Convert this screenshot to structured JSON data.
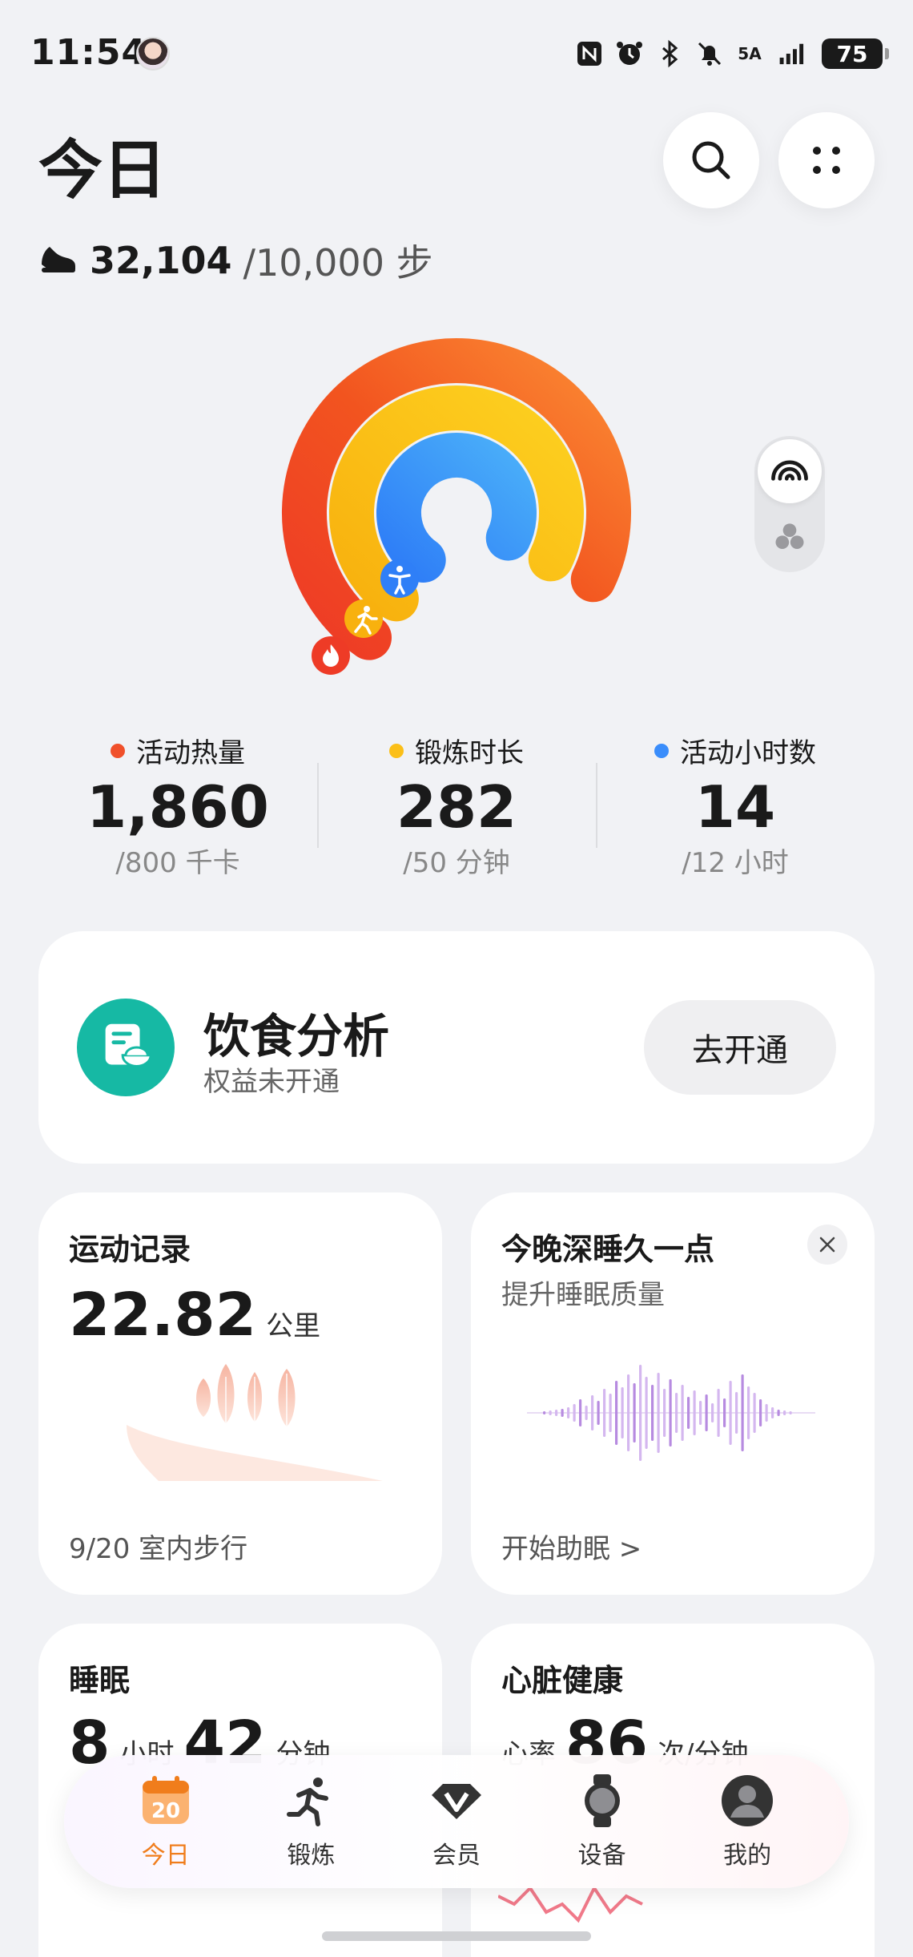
{
  "status_bar": {
    "time": "11:54",
    "network": "5A",
    "battery": "75",
    "icons": [
      "nfc-icon",
      "alarm-icon",
      "bluetooth-icon",
      "mute-icon",
      "signal-icon",
      "battery-icon"
    ]
  },
  "header": {
    "title": "今日",
    "search_icon": "search-icon",
    "more_icon": "more-grid-icon"
  },
  "steps": {
    "value": "32,104",
    "goal": "/10,000 步",
    "icon": "shoe-icon"
  },
  "rings": {
    "calories": 0.9,
    "exercise": 0.9,
    "active_hours": 0.9,
    "colors": {
      "calories": "#f0502a",
      "exercise": "#fbbf18",
      "active_hours": "#3a8dfb"
    }
  },
  "ring_toggle": {
    "selected_icon": "rings-icon",
    "other_icon": "circles-icon"
  },
  "stats": [
    {
      "label": "活动热量",
      "value": "1,860",
      "goal": "/800 千卡",
      "color": "#f0502a"
    },
    {
      "label": "锻炼时长",
      "value": "282",
      "goal": "/50 分钟",
      "color": "#fbbf18"
    },
    {
      "label": "活动小时数",
      "value": "14",
      "goal": "/12 小时",
      "color": "#3a8dfb"
    }
  ],
  "diet": {
    "title": "饮食分析",
    "subtitle": "权益未开通",
    "button": "去开通",
    "icon": "diet-icon"
  },
  "exercise_record": {
    "title": "运动记录",
    "value": "22.82",
    "unit": "公里",
    "footer": "9/20 室内步行"
  },
  "sleep_aid": {
    "title": "今晚深睡久一点",
    "subtitle": "提升睡眠质量",
    "footer": "开始助眠 >"
  },
  "sleep": {
    "title": "睡眠",
    "hours": "8",
    "hours_unit": "小时",
    "minutes": "42",
    "minutes_unit": "分钟"
  },
  "heart": {
    "title": "心脏健康",
    "label": "心率",
    "value": "86",
    "unit": "次/分钟"
  },
  "bottom_nav": [
    {
      "label": "今日",
      "icon": "calendar-icon",
      "badge": "20",
      "active": true
    },
    {
      "label": "锻炼",
      "icon": "runner-icon",
      "active": false
    },
    {
      "label": "会员",
      "icon": "vip-icon",
      "active": false
    },
    {
      "label": "设备",
      "icon": "watch-icon",
      "active": false
    },
    {
      "label": "我的",
      "icon": "profile-icon",
      "active": false
    }
  ]
}
